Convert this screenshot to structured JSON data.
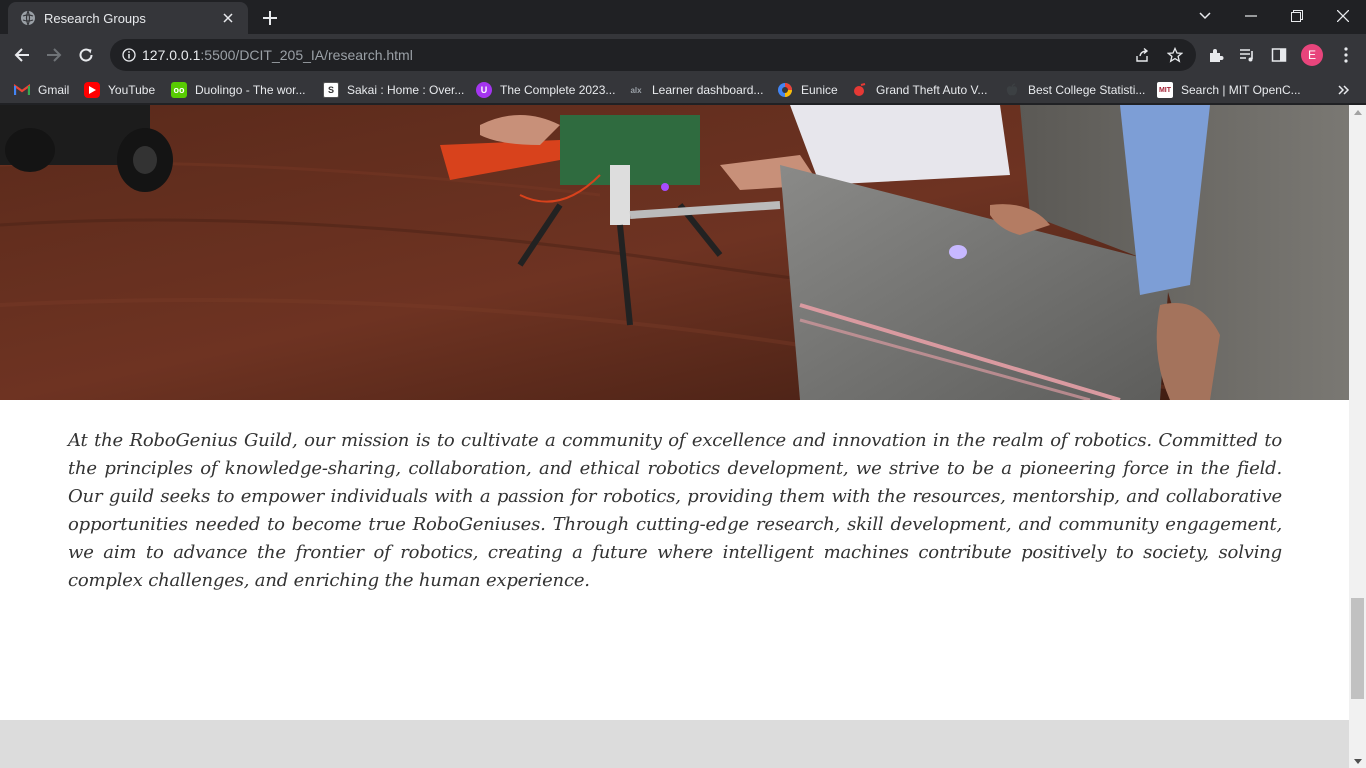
{
  "browser": {
    "tab": {
      "title": "Research Groups",
      "favicon": "globe-icon"
    },
    "address": {
      "host": "127.0.0.1",
      "rest": ":5500/DCIT_205_IA/research.html"
    },
    "profile_initial": "E",
    "profile_color": "#e8457c"
  },
  "bookmarks": [
    {
      "label": "Gmail",
      "icon": "gmail-icon",
      "color": "#ea4335"
    },
    {
      "label": "YouTube",
      "icon": "youtube-icon",
      "color": "#ff0000"
    },
    {
      "label": "Duolingo - The wor...",
      "icon": "duolingo-icon",
      "color": "#58cc02"
    },
    {
      "label": "Sakai : Home : Over...",
      "icon": "sakai-icon",
      "color": "#ffffff"
    },
    {
      "label": "The Complete 2023...",
      "icon": "udemy-icon",
      "color": "#a435f0"
    },
    {
      "label": "Learner dashboard...",
      "icon": "alx-icon",
      "color": "#9aa0a6"
    },
    {
      "label": "Eunice",
      "icon": "eunice-icon",
      "color": "#4285f4"
    },
    {
      "label": "Grand Theft Auto V...",
      "icon": "gta-icon",
      "color": "#e53935"
    },
    {
      "label": "Best College Statisti...",
      "icon": "apple-icon",
      "color": "#9aa0a6"
    },
    {
      "label": "Search | MIT OpenC...",
      "icon": "mit-icon",
      "color": "#a31f34"
    }
  ],
  "page": {
    "mission_text": "At the RoboGenius Guild, our mission is to cultivate a community of excellence and innovation in the realm of robotics. Committed to the principles of knowledge-sharing, collaboration, and ethical robotics development, we strive to be a pioneering force in the field. Our guild seeks to empower individuals with a passion for robotics, providing them with the resources, mentorship, and collaborative opportunities needed to become true RoboGeniuses. Through cutting-edge research, skill development, and community engagement, we aim to advance the frontier of robotics, creating a future where intelligent machines contribute positively to society, solving complex challenges, and enriching the human experience."
  }
}
